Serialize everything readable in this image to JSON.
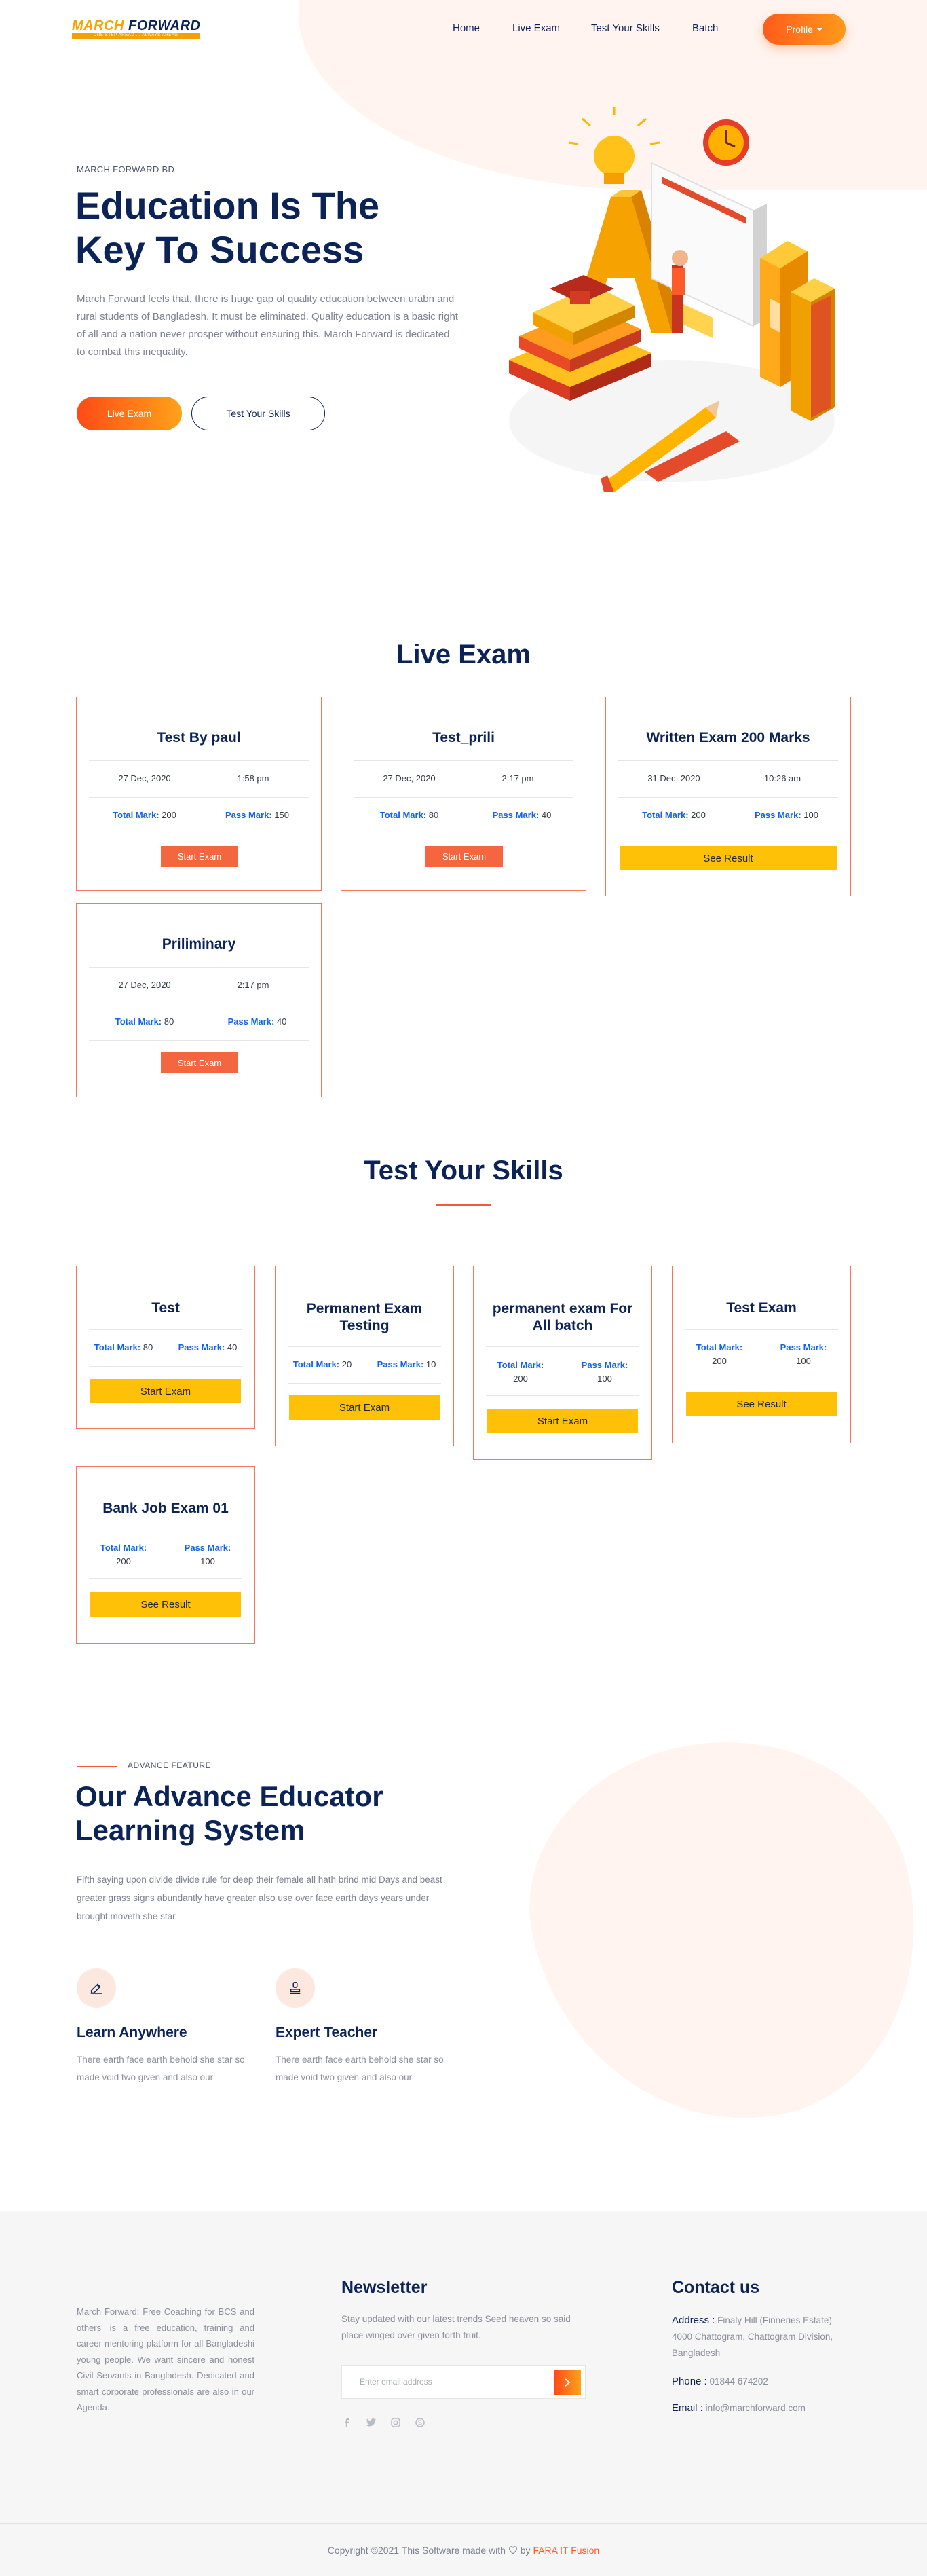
{
  "header": {
    "logo_first": "MARCH",
    "logo_second": "FORWARD",
    "logo_tagline": "ONE STEP AHEAD ... ALWAYS AHEAD",
    "nav": [
      "Home",
      "Live Exam",
      "Test Your Skills",
      "Batch"
    ],
    "profile_label": "Profile"
  },
  "hero": {
    "eyebrow": "MARCH FORWARD BD",
    "title": "Education Is The Key To Success",
    "description": "March Forward feels that, there is huge gap of quality education between urabn and rural students of Bangladesh. It must be eliminated. Quality education is a basic right of all and a nation never prosper without ensuring this. March Forward is dedicated to combat this inequality.",
    "btn_primary": "Live Exam",
    "btn_secondary": "Test Your Skills"
  },
  "live_exam": {
    "title": "Live Exam",
    "total_label": "Total Mark:",
    "pass_label": "Pass Mark:",
    "cards": [
      {
        "title": "Test By paul",
        "date": "27 Dec, 2020",
        "time": "1:58 pm",
        "total": "200",
        "pass": "150",
        "action": "Start Exam"
      },
      {
        "title": "Test_prili",
        "date": "27 Dec, 2020",
        "time": "2:17 pm",
        "total": "80",
        "pass": "40",
        "action": "Start Exam"
      },
      {
        "title": "Written Exam 200 Marks",
        "date": "31 Dec, 2020",
        "time": "10:26 am",
        "total": "200",
        "pass": "100",
        "action": "See Result"
      },
      {
        "title": "Priliminary",
        "date": "27 Dec, 2020",
        "time": "2:17 pm",
        "total": "80",
        "pass": "40",
        "action": "Start Exam"
      }
    ]
  },
  "skills": {
    "title": "Test Your Skills",
    "total_label": "Total Mark:",
    "pass_label": "Pass Mark:",
    "cards": [
      {
        "title": "Test",
        "total": "80",
        "pass": "40",
        "action": "Start Exam"
      },
      {
        "title": "Permanent Exam Testing",
        "total": "20",
        "pass": "10",
        "action": "Start Exam"
      },
      {
        "title": "permanent exam For All batch",
        "total": "200",
        "pass": "100",
        "action": "Start Exam"
      },
      {
        "title": "Test Exam",
        "total": "200",
        "pass": "100",
        "action": "See Result"
      },
      {
        "title": "Bank Job Exam 01",
        "total": "200",
        "pass": "100",
        "action": "See Result"
      }
    ]
  },
  "features": {
    "eyebrow": "ADVANCE FEATURE",
    "title": "Our Advance Educator Learning System",
    "description": "Fifth saying upon divide divide rule for deep their female all hath brind mid Days and beast greater grass signs abundantly have greater also use over face earth days years under brought moveth she star",
    "items": [
      {
        "icon": "edit-icon",
        "name": "Learn Anywhere",
        "text": "There earth face earth behold she star so made void two given and also our"
      },
      {
        "icon": "stamp-icon",
        "name": "Expert Teacher",
        "text": "There earth face earth behold she star so made void two given and also our"
      }
    ]
  },
  "footer": {
    "about": "March Forward: Free Coaching for BCS and others' is a free education, training and career mentoring platform for all Bangladeshi young people. We want sincere and honest Civil Servants in Bangladesh. Dedicated and smart corporate professionals are also in our Agenda.",
    "newsletter_title": "Newsletter",
    "newsletter_text": "Stay updated with our latest trends Seed heaven so said place winged over given forth fruit.",
    "newsletter_placeholder": "Enter email address",
    "social": [
      "facebook-icon",
      "twitter-icon",
      "instagram-icon",
      "skype-icon"
    ],
    "contact_title": "Contact us",
    "address_label": "Address :",
    "address_value": "Finaly Hill (Finneries Estate) 4000 Chattogram, Chattogram Division, Bangladesh",
    "phone_label": "Phone :",
    "phone_value": "01844 674202",
    "email_label": "Email :",
    "email_value": "info@marchforward.com",
    "copyright_prefix": "Copyright ©2021 This Software made with",
    "copyright_by": "by",
    "copyright_brand": "FARA IT Fusion"
  },
  "colors": {
    "navy": "#0b2357",
    "accent": "#ff5b1d",
    "accent_yellow": "#fec107",
    "card_border": "#f4775b",
    "link_blue": "#1362e8"
  }
}
